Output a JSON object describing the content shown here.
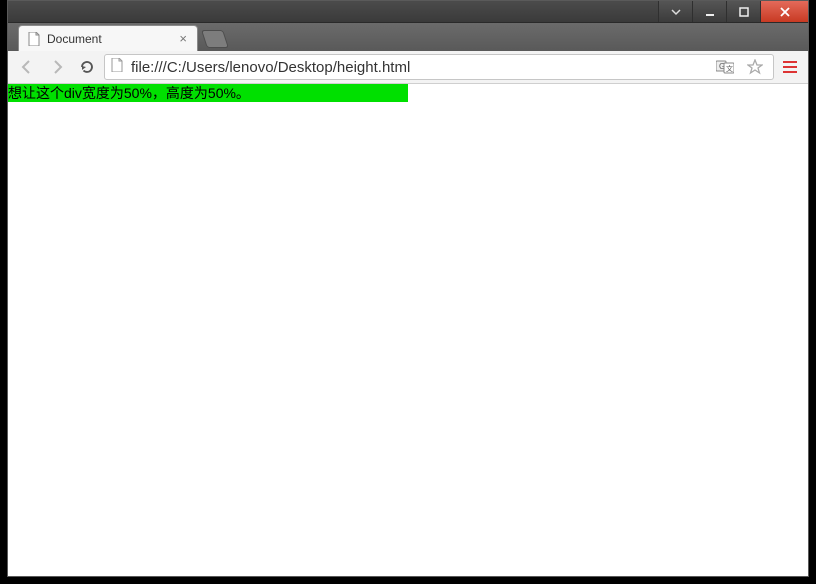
{
  "window": {
    "controls": {
      "down_tooltip": "Show desktop preview",
      "min_tooltip": "Minimize",
      "max_tooltip": "Maximize",
      "close_tooltip": "Close"
    }
  },
  "tabs": [
    {
      "title": "Document",
      "favicon": "file-icon"
    }
  ],
  "toolbar": {
    "back_tooltip": "Back",
    "forward_tooltip": "Forward",
    "reload_tooltip": "Reload",
    "url": "file:///C:/Users/lenovo/Desktop/height.html",
    "translate_tooltip": "Translate this page",
    "bookmark_tooltip": "Bookmark this page",
    "menu_tooltip": "Customize and control"
  },
  "page": {
    "green_text": "想让这个div宽度为50%，高度为50%。"
  },
  "colors": {
    "green": "#00e000",
    "close_red": "#c83a23",
    "menu_red": "#d33"
  }
}
